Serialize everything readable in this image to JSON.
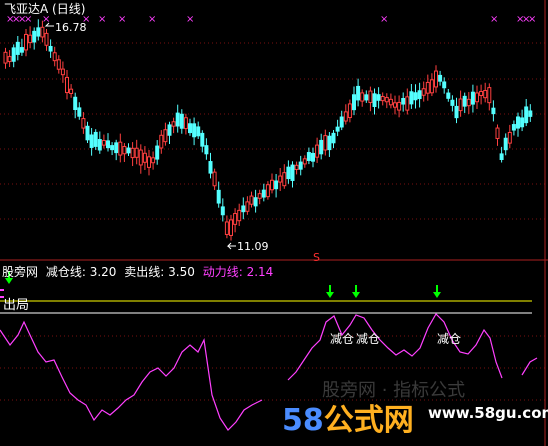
{
  "top_panel": {
    "title": "飞亚达A (日线)",
    "high_marker": "16.78",
    "low_marker": "11.09",
    "s_marker": "S",
    "x_mark_char": "×",
    "bull_color": "#ff4040",
    "bear_color": "#54ffff",
    "title_color": "#ffffff"
  },
  "indicator_panel": {
    "name": "股旁网",
    "items": [
      {
        "label": "减仓线:",
        "value": "3.20",
        "color": "#ffffff"
      },
      {
        "label": "卖出线:",
        "value": "3.50",
        "color": "#ffffff"
      },
      {
        "label": "动力线:",
        "value": "2.14",
        "color": "#ff40ff"
      }
    ],
    "exit_label": "出局",
    "reduce_labels": [
      "减仓",
      "减仓",
      "减仓"
    ],
    "line_color": "#ff40ff",
    "level_line_color": "#ffff00",
    "arrow_color": "#00ff00"
  },
  "watermark": {
    "brand_a": "58",
    "brand_b": "公式网",
    "url": "www.58gu.com",
    "faint": "股旁网 · 指标公式"
  }
}
